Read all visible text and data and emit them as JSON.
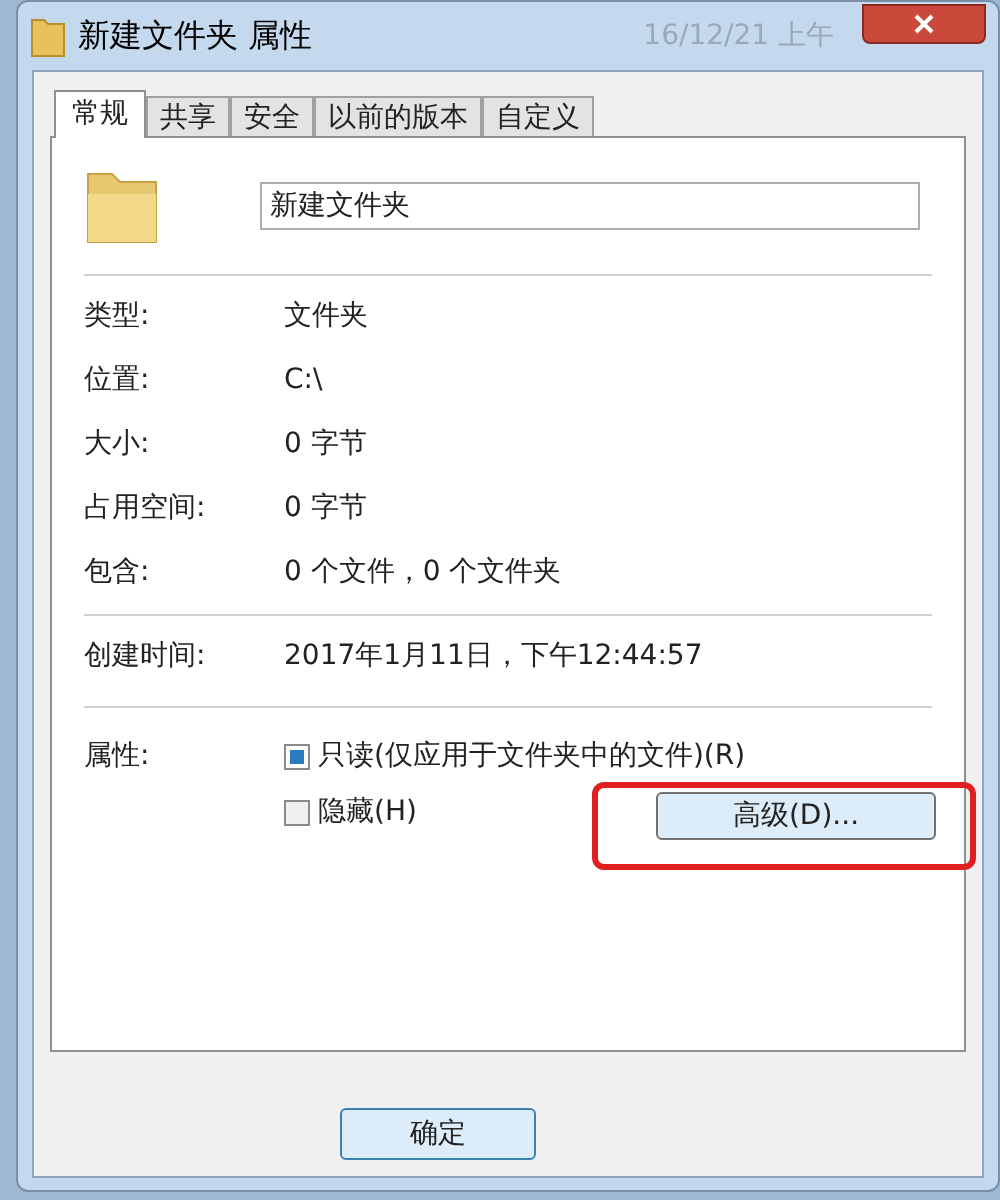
{
  "window": {
    "title": "新建文件夹 属性",
    "background_text": "16/12/21 上午"
  },
  "tabs": [
    {
      "label": "常规",
      "selected": true
    },
    {
      "label": "共享",
      "selected": false
    },
    {
      "label": "安全",
      "selected": false
    },
    {
      "label": "以前的版本",
      "selected": false
    },
    {
      "label": "自定义",
      "selected": false
    }
  ],
  "name_field": {
    "value": "新建文件夹"
  },
  "info_groups": [
    [
      {
        "label": "类型:",
        "value": "文件夹"
      },
      {
        "label": "位置:",
        "value": "C:\\"
      },
      {
        "label": "大小:",
        "value": "0 字节"
      },
      {
        "label": "占用空间:",
        "value": "0 字节"
      },
      {
        "label": "包含:",
        "value": "0 个文件，0 个文件夹"
      }
    ],
    [
      {
        "label": "创建时间:",
        "value": "2017年1月11日，下午12:44:57"
      }
    ]
  ],
  "attributes": {
    "label": "属性:",
    "checkboxes": [
      {
        "label": "只读(仅应用于文件夹中的文件)(R)",
        "checked": false,
        "mixed": true
      },
      {
        "label": "隐藏(H)",
        "checked": false,
        "mixed": false
      }
    ],
    "advanced_button": "高级(D)...",
    "highlighted": true
  },
  "buttons": [
    "确定"
  ]
}
